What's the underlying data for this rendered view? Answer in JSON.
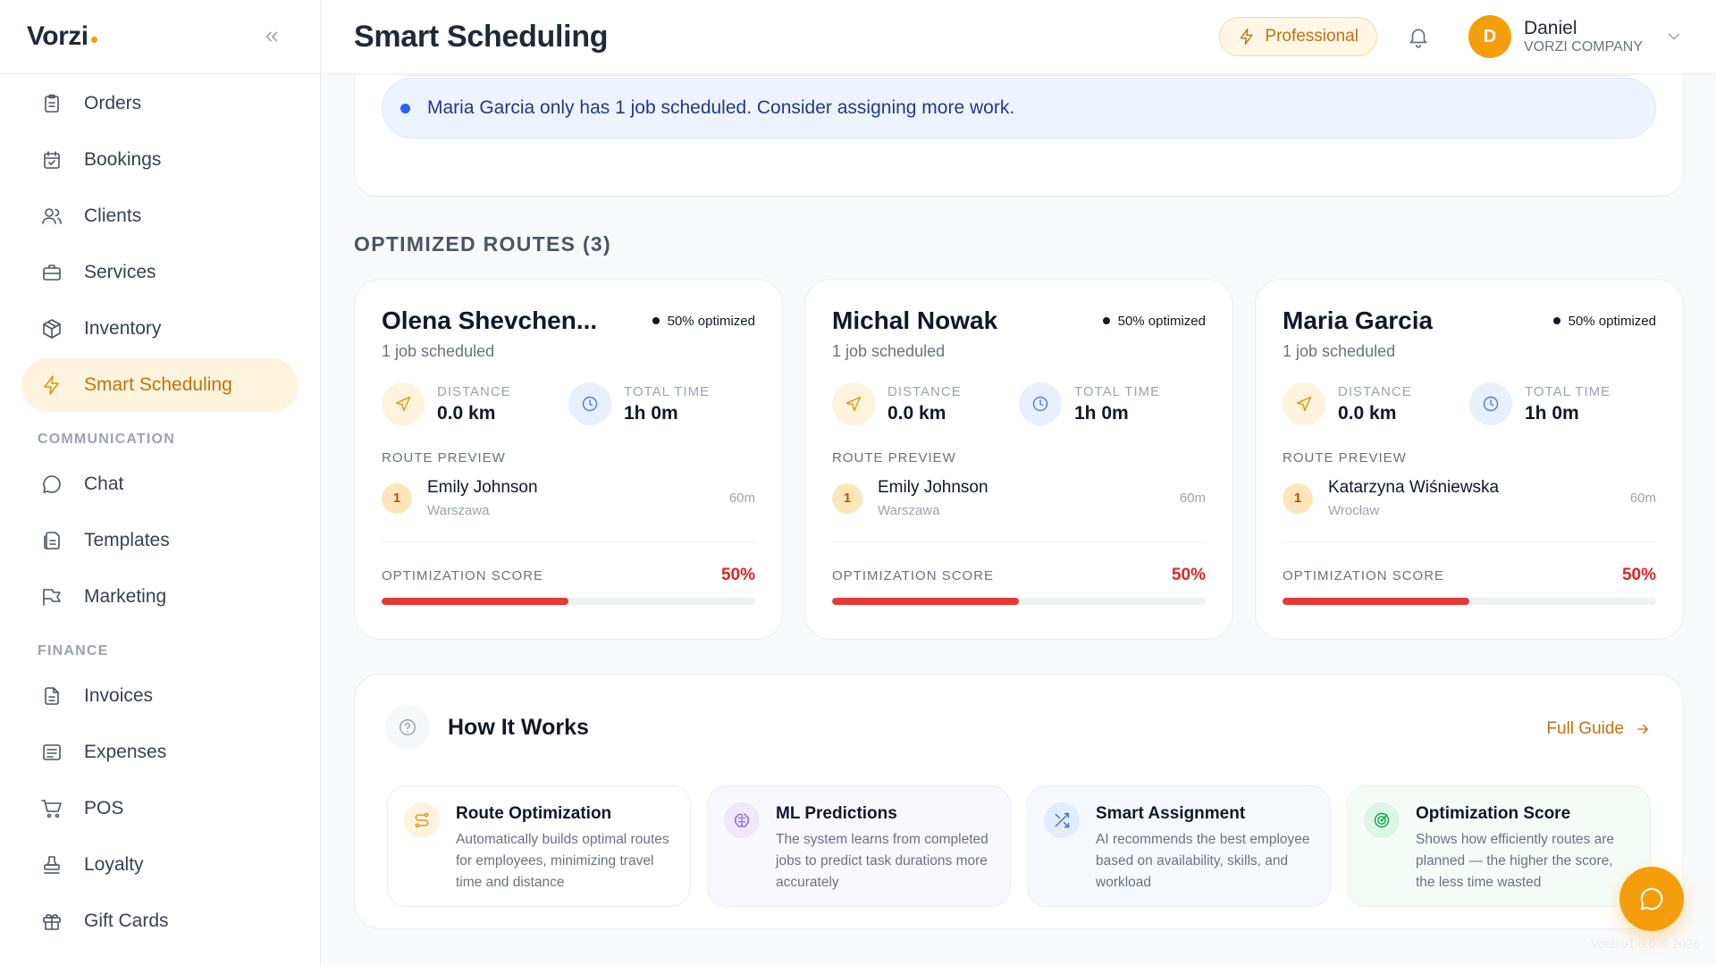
{
  "brand": {
    "name": "Vorzi",
    "accent": "#f59e0b"
  },
  "header": {
    "title": "Smart Scheduling",
    "plan": "Professional",
    "user": {
      "initial": "D",
      "name": "Daniel",
      "company": "VORZI COMPANY"
    }
  },
  "sidebar": {
    "items": [
      {
        "label": "Orders",
        "icon": "clipboard-icon"
      },
      {
        "label": "Bookings",
        "icon": "calendar-check-icon"
      },
      {
        "label": "Clients",
        "icon": "users-icon"
      },
      {
        "label": "Services",
        "icon": "briefcase-icon"
      },
      {
        "label": "Inventory",
        "icon": "package-icon"
      },
      {
        "label": "Smart Scheduling",
        "icon": "lightning-icon",
        "active": true
      }
    ],
    "communication_label": "COMMUNICATION",
    "communication": [
      {
        "label": "Chat",
        "icon": "chat-bubble-icon"
      },
      {
        "label": "Templates",
        "icon": "template-icon"
      },
      {
        "label": "Marketing",
        "icon": "flag-icon"
      }
    ],
    "finance_label": "FINANCE",
    "finance": [
      {
        "label": "Invoices",
        "icon": "invoice-icon"
      },
      {
        "label": "Expenses",
        "icon": "receipt-icon"
      },
      {
        "label": "POS",
        "icon": "cart-icon"
      },
      {
        "label": "Loyalty",
        "icon": "stamp-icon"
      },
      {
        "label": "Gift Cards",
        "icon": "gift-icon"
      }
    ]
  },
  "alerts": {
    "partial": "",
    "maria": "Maria Garcia only has 1 job scheduled. Consider assigning more work."
  },
  "routes_title": "OPTIMIZED ROUTES (3)",
  "route_labels": {
    "distance": "DISTANCE",
    "total_time": "TOTAL TIME",
    "preview": "ROUTE PREVIEW",
    "score": "OPTIMIZATION SCORE"
  },
  "routes": [
    {
      "name": "Olena Shevchen...",
      "optimized": "50% optimized",
      "jobs": "1 job scheduled",
      "distance": "0.0 km",
      "time": "1h 0m",
      "stop": {
        "num": "1",
        "name": "Emily Johnson",
        "city": "Warszawa",
        "duration": "60m"
      },
      "score": "50%",
      "score_value": 50
    },
    {
      "name": "Michal Nowak",
      "optimized": "50% optimized",
      "jobs": "1 job scheduled",
      "distance": "0.0 km",
      "time": "1h 0m",
      "stop": {
        "num": "1",
        "name": "Emily Johnson",
        "city": "Warszawa",
        "duration": "60m"
      },
      "score": "50%",
      "score_value": 50
    },
    {
      "name": "Maria Garcia",
      "optimized": "50% optimized",
      "jobs": "1 job scheduled",
      "distance": "0.0 km",
      "time": "1h 0m",
      "stop": {
        "num": "1",
        "name": "Katarzyna Wiśniewska",
        "city": "Wrocław",
        "duration": "60m"
      },
      "score": "50%",
      "score_value": 50
    }
  ],
  "how": {
    "title": "How It Works",
    "guide": "Full Guide",
    "features": [
      {
        "title": "Route Optimization",
        "desc": "Automatically builds optimal routes for employees, minimizing travel time and distance",
        "icon": "route-icon"
      },
      {
        "title": "ML Predictions",
        "desc": "The system learns from completed jobs to predict task durations more accurately",
        "icon": "brain-icon"
      },
      {
        "title": "Smart Assignment",
        "desc": "AI recommends the best employee based on availability, skills, and workload",
        "icon": "shuffle-icon"
      },
      {
        "title": "Optimization Score",
        "desc": "Shows how efficiently routes are planned — the higher the score, the less time wasted",
        "icon": "target-icon"
      }
    ]
  },
  "version": "Vorzi v1.0.0 © 2026"
}
